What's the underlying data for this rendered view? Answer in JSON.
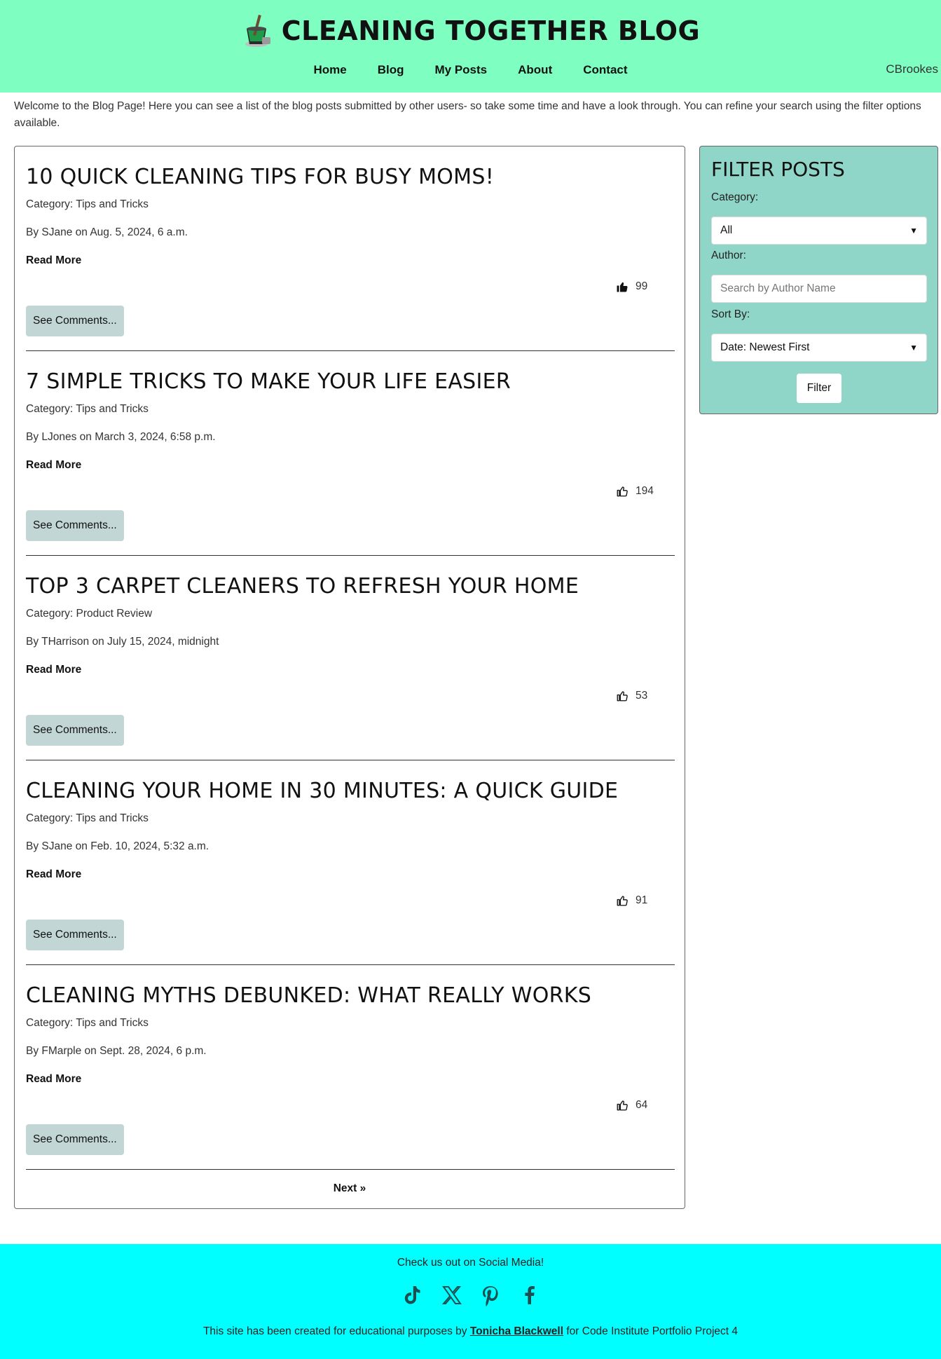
{
  "header": {
    "title": "CLEANING TOGETHER BLOG",
    "nav": [
      "Home",
      "Blog",
      "My Posts",
      "About",
      "Contact"
    ],
    "user": "CBrookes",
    "bg_color": "#7effc1"
  },
  "intro": "Welcome to the Blog Page! Here you can see a list of the blog posts submitted by other users- so take some time and have a look through. You can refine your search using the filter options available.",
  "posts": [
    {
      "title": "10 QUICK CLEANING TIPS FOR BUSY MOMS!",
      "category": "Category: Tips and Tricks",
      "byline": "By SJane on Aug. 5, 2024, 6 a.m.",
      "read_more": "Read More",
      "likes": "99",
      "liked": true,
      "comments": "See Comments..."
    },
    {
      "title": "7 SIMPLE TRICKS TO MAKE YOUR LIFE EASIER",
      "category": "Category: Tips and Tricks",
      "byline": "By LJones on March 3, 2024, 6:58 p.m.",
      "read_more": "Read More",
      "likes": "194",
      "liked": false,
      "comments": "See Comments..."
    },
    {
      "title": "TOP 3 CARPET CLEANERS TO REFRESH YOUR HOME",
      "category": "Category: Product Review",
      "byline": "By THarrison on July 15, 2024, midnight",
      "read_more": "Read More",
      "likes": "53",
      "liked": false,
      "comments": "See Comments..."
    },
    {
      "title": "CLEANING YOUR HOME IN 30 MINUTES: A QUICK GUIDE",
      "category": "Category: Tips and Tricks",
      "byline": "By SJane on Feb. 10, 2024, 5:32 a.m.",
      "read_more": "Read More",
      "likes": "91",
      "liked": false,
      "comments": "See Comments..."
    },
    {
      "title": "CLEANING MYTHS DEBUNKED: WHAT REALLY WORKS",
      "category": "Category: Tips and Tricks",
      "byline": "By FMarple on Sept. 28, 2024, 6 p.m.",
      "read_more": "Read More",
      "likes": "64",
      "liked": false,
      "comments": "See Comments..."
    }
  ],
  "pagination": {
    "next": "Next »"
  },
  "filter": {
    "title": "FILTER POSTS",
    "category_label": "Category:",
    "category_value": "All",
    "author_label": "Author:",
    "author_placeholder": "Search by Author Name",
    "sort_label": "Sort By:",
    "sort_value": "Date: Newest First",
    "button": "Filter",
    "bg_color": "#8fd6c8"
  },
  "footer": {
    "cta": "Check us out on Social Media!",
    "socials": [
      "tiktok-icon",
      "x-icon",
      "pinterest-icon",
      "facebook-icon"
    ],
    "credit_prefix": "This site has been created for educational purposes by ",
    "credit_name": "Tonicha Blackwell",
    "credit_suffix": " for Code Institute Portfolio Project 4",
    "bg_color": "#00ffff"
  }
}
